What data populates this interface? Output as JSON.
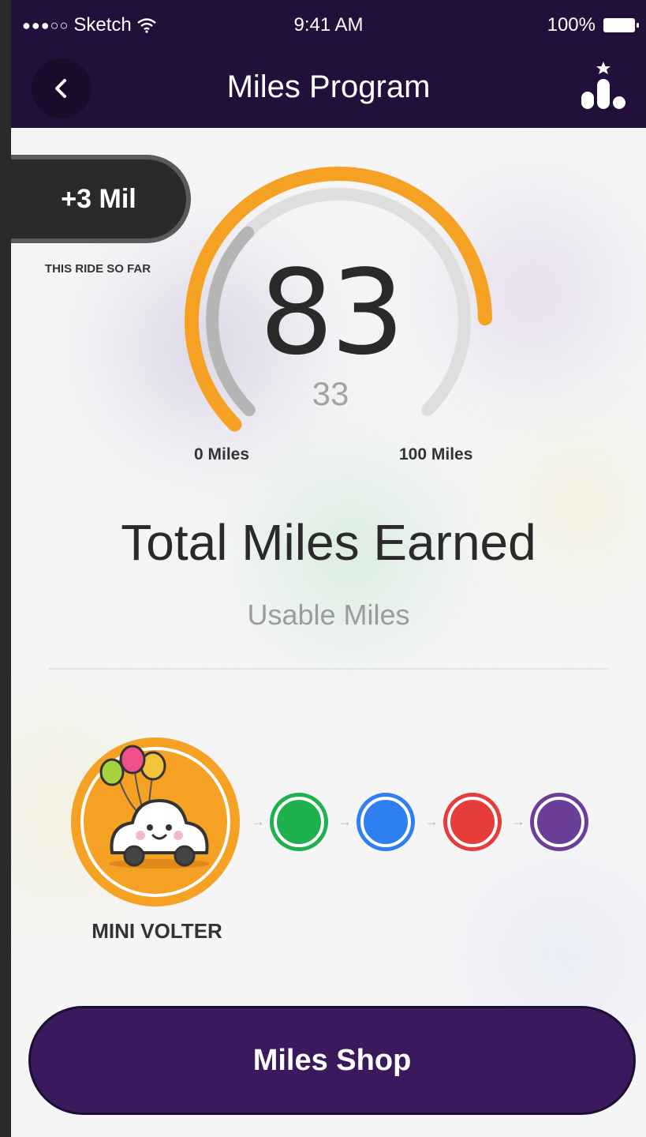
{
  "status_bar": {
    "signal": "●●●○○",
    "carrier": "Sketch",
    "time": "9:41 AM",
    "battery": "100%"
  },
  "nav": {
    "title": "Miles Program",
    "back_icon": "chevron-left-icon",
    "leaderboard_icon": "leaderboard-icon"
  },
  "ride": {
    "miles_label": "+3 Mil",
    "caption": "THIS RIDE SO FAR"
  },
  "gauge": {
    "value": "83",
    "sub_value": "33",
    "min_label": "0 Miles",
    "max_label": "100 Miles",
    "total_progress": 0.83,
    "usable_progress": 0.33,
    "colors": {
      "total": "#f4a124",
      "usable": "#b5b5b5",
      "track": "#dedede"
    }
  },
  "summary": {
    "title": "Total Miles Earned",
    "subtitle": "Usable Miles"
  },
  "levels": {
    "current": "MINI VOLTER",
    "current_color": "#f4a124",
    "next": [
      {
        "name": "level-green",
        "color": "#1fb14e"
      },
      {
        "name": "level-blue",
        "color": "#2f7ff0"
      },
      {
        "name": "level-red",
        "color": "#e63c3c"
      },
      {
        "name": "level-purple",
        "color": "#6a3e99"
      }
    ]
  },
  "shop": {
    "label": "Miles Shop"
  }
}
